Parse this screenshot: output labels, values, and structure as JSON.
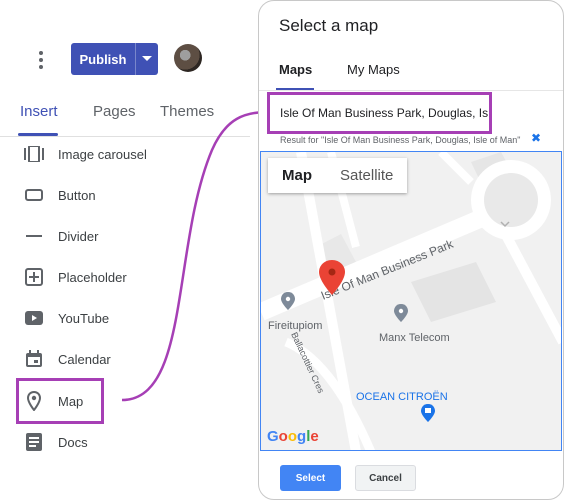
{
  "sidebar": {
    "menu_icon": "more-vert-icon",
    "publish_label": "Publish",
    "tabs": [
      {
        "label": "Insert",
        "active": true
      },
      {
        "label": "Pages",
        "active": false
      },
      {
        "label": "Themes",
        "active": false
      }
    ],
    "items": [
      {
        "label": "Image carousel",
        "icon": "image-carousel-icon"
      },
      {
        "label": "Button",
        "icon": "button-icon"
      },
      {
        "label": "Divider",
        "icon": "divider-icon"
      },
      {
        "label": "Placeholder",
        "icon": "placeholder-icon"
      },
      {
        "label": "YouTube",
        "icon": "youtube-icon"
      },
      {
        "label": "Calendar",
        "icon": "calendar-icon"
      },
      {
        "label": "Map",
        "icon": "map-pin-icon",
        "highlighted": true
      },
      {
        "label": "Docs",
        "icon": "docs-icon"
      }
    ]
  },
  "dialog": {
    "title": "Select a map",
    "tabs": [
      {
        "label": "Maps",
        "active": true
      },
      {
        "label": "My Maps",
        "active": false
      }
    ],
    "search": {
      "value": "Isle Of Man Business Park, Douglas, Isle of Man"
    },
    "result_text": "Result for \"Isle Of Man Business Park, Douglas, Isle of Man\"",
    "map": {
      "view_options": [
        "Map",
        "Satellite"
      ],
      "active_view": "Map",
      "road_label": "Isle Of Man Business Park",
      "side_road_label": "Ballacottier Cres",
      "places": [
        {
          "name": "Fireitupiom"
        },
        {
          "name": "Manx Telecom"
        },
        {
          "name": "OCEAN CITROËN"
        }
      ],
      "logo": "Google"
    },
    "select_label": "Select",
    "cancel_label": "Cancel"
  },
  "colors": {
    "accent": "#3f51b5",
    "highlight": "#a63fb5",
    "select_button": "#4285f4",
    "marker": "#ea4335",
    "citroen_poi": "#1a73e8"
  }
}
